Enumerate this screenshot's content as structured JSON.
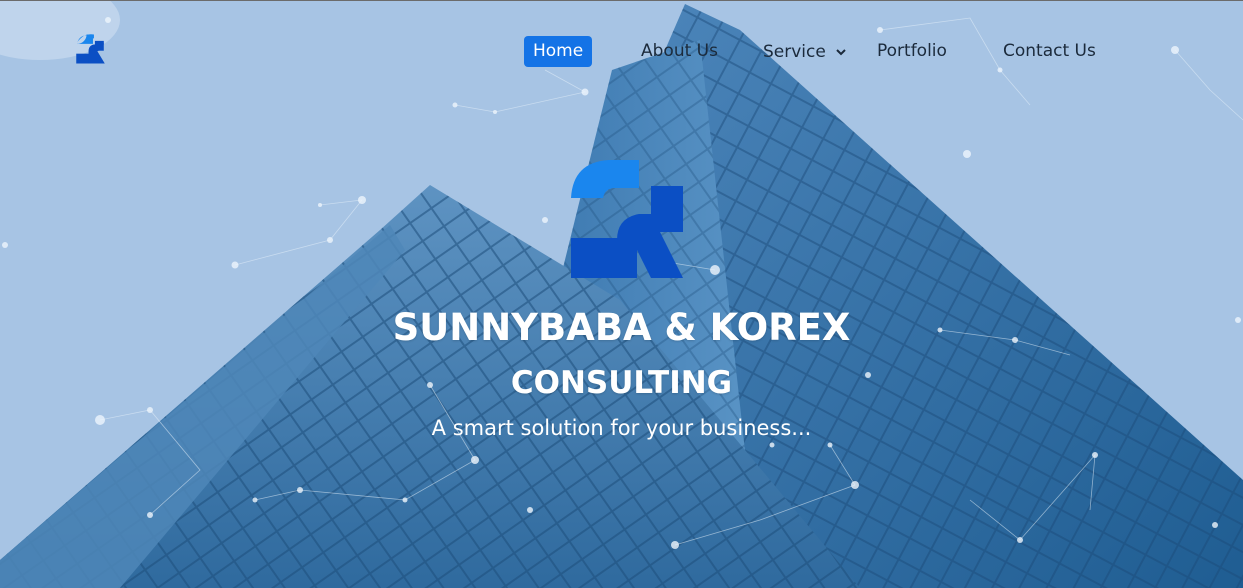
{
  "brand": {
    "logo_icon": "sk-logo-icon",
    "primary_color": "#0b4fc4",
    "accent_color": "#1a86ee"
  },
  "nav": {
    "items": [
      {
        "label": "Home",
        "active": true
      },
      {
        "label": "About Us",
        "active": false
      },
      {
        "label": "Service",
        "active": false,
        "dropdown": true,
        "icon": "chevron-down-icon"
      },
      {
        "label": "Portfolio",
        "active": false
      },
      {
        "label": "Contact Us",
        "active": false
      }
    ],
    "active_color": "#1473e6"
  },
  "hero": {
    "title_line1": "SUNNYBABA & KOREX",
    "title_line2": "CONSULTING",
    "tagline": "A smart solution for your business...",
    "background": "skyscraper-with-network-overlay"
  }
}
